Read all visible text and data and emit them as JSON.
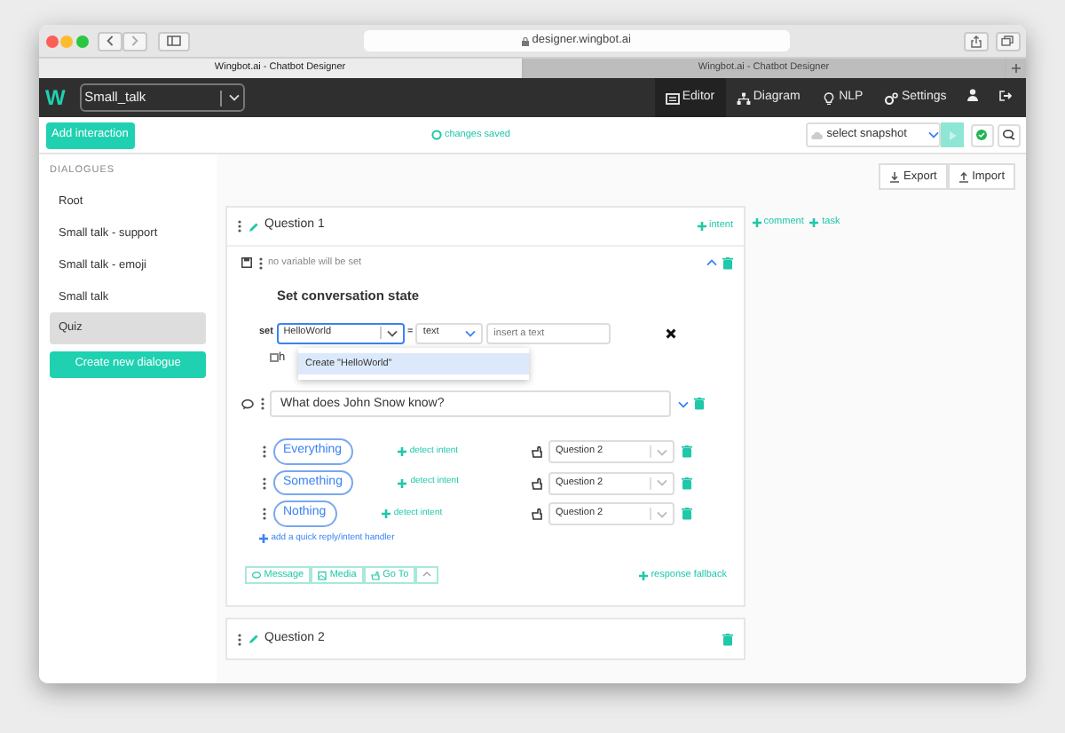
{
  "browser": {
    "url": "designer.wingbot.ai",
    "tabs": [
      {
        "title": "Wingbot.ai - Chatbot Designer",
        "selected": true
      },
      {
        "title": "Wingbot.ai - Chatbot Designer",
        "selected": false
      }
    ]
  },
  "navbar": {
    "logo": "W",
    "bot_select": "Small_talk",
    "items": [
      {
        "label": "Editor",
        "selected": true
      },
      {
        "label": "Diagram",
        "selected": false
      },
      {
        "label": "NLP",
        "selected": false
      },
      {
        "label": "Settings",
        "selected": false
      }
    ]
  },
  "toolbar": {
    "add_button": "Add interaction",
    "status": "changes saved",
    "snapshot_placeholder": "select snapshot"
  },
  "sidebar": {
    "heading": "DIALOGUES",
    "items": [
      {
        "label": "Root",
        "selected": false
      },
      {
        "label": "Small talk - support",
        "selected": false
      },
      {
        "label": "Small talk - emoji",
        "selected": false
      },
      {
        "label": "Small talk",
        "selected": false
      },
      {
        "label": "Quiz",
        "selected": true
      }
    ],
    "create_button": "Create new dialogue"
  },
  "actions": [
    "Export",
    "Import"
  ],
  "side_links": [
    "comment",
    "task"
  ],
  "interaction": {
    "title": "Question 1",
    "intent_link": "intent",
    "state": {
      "note": "no variable will be set",
      "heading": "Set conversation state",
      "set_label": "set",
      "variable": "HelloWorld",
      "operator": "=",
      "type": "text",
      "value_placeholder": "insert a text",
      "checkbox_label": "h",
      "checked": false,
      "menu_option": "Create \"HelloWorld\""
    },
    "message": "What does John Snow know?",
    "quick_replies": [
      {
        "label": "Everything",
        "link": "detect intent",
        "target": "Question 2"
      },
      {
        "label": "Something",
        "link": "detect intent",
        "target": "Question 2"
      },
      {
        "label": "Nothing",
        "link": "detect intent",
        "target": "Question 2"
      }
    ],
    "add_handler": "add a quick reply/intent handler",
    "add_buttons": [
      "Message",
      "Media",
      "Go To"
    ],
    "fallback_link": "response fallback"
  },
  "next_interaction": {
    "title": "Question 2"
  }
}
